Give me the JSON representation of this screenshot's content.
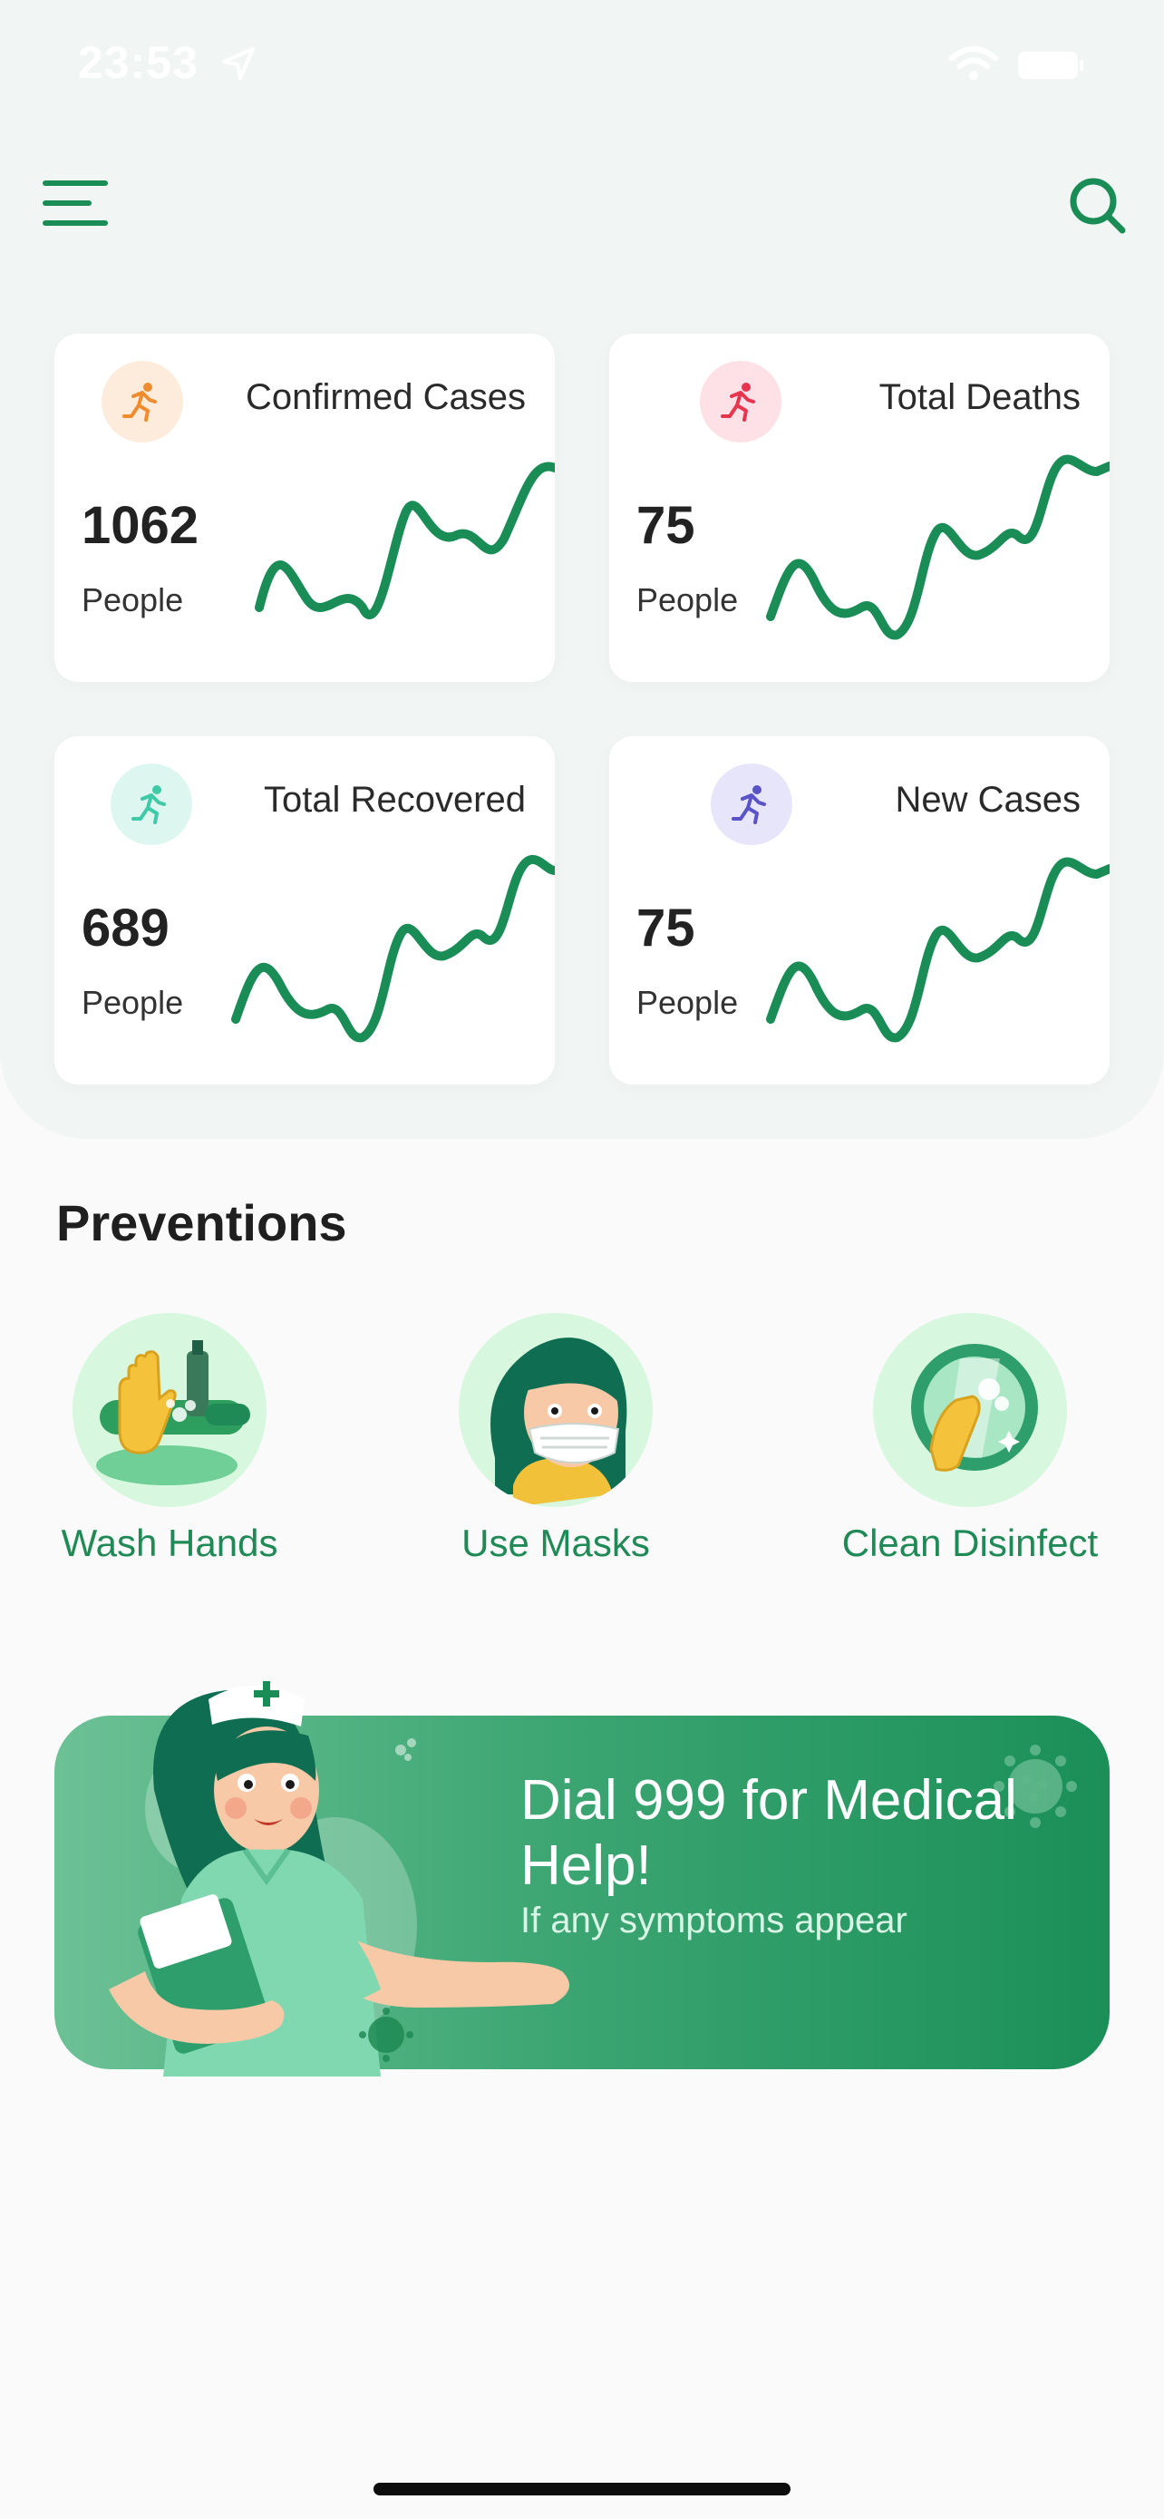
{
  "status_bar": {
    "time": "23:53"
  },
  "header": {
    "menu_icon": "menu-icon",
    "search_icon": "search-icon"
  },
  "stats": [
    {
      "title": "Confirmed Cases",
      "value": "1062",
      "unit": "People",
      "icon": "running-person-icon",
      "icon_color": "#f08c2e",
      "icon_bg": "#fdecdc"
    },
    {
      "title": "Total Deaths",
      "value": "75",
      "unit": "People",
      "icon": "running-person-icon",
      "icon_color": "#e8354f",
      "icon_bg": "#fde1e6"
    },
    {
      "title": "Total Recovered",
      "value": "689",
      "unit": "People",
      "icon": "running-person-icon",
      "icon_color": "#3ec9a7",
      "icon_bg": "#ddf7f0"
    },
    {
      "title": "New Cases",
      "value": "75",
      "unit": "People",
      "icon": "running-person-icon",
      "icon_color": "#5a52c8",
      "icon_bg": "#e7e5f9"
    }
  ],
  "sparkline_color": "#1a8d57",
  "preventions": {
    "title": "Preventions",
    "items": [
      {
        "label": "Wash Hands",
        "icon": "wash-hands-illustration"
      },
      {
        "label": "Use Masks",
        "icon": "use-masks-illustration"
      },
      {
        "label": "Clean Disinfect",
        "icon": "clean-disinfect-illustration"
      }
    ]
  },
  "banner": {
    "title": "Dial 999 for Medical Help!",
    "subtitle": "If any symptoms appear",
    "illustration": "nurse-illustration"
  },
  "colors": {
    "accent": "#1a8d57",
    "label_green": "#1f8a55"
  }
}
